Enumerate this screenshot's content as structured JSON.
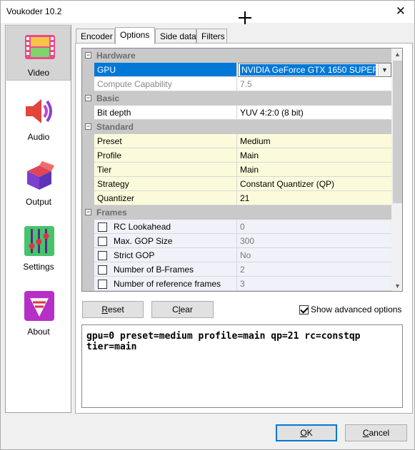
{
  "window": {
    "title": "Voukoder 10.2",
    "close_glyph": "✕"
  },
  "sidebar": {
    "items": [
      {
        "label": "Video",
        "icon": "film-icon",
        "selected": true
      },
      {
        "label": "Audio",
        "icon": "speaker-icon",
        "selected": false
      },
      {
        "label": "Output",
        "icon": "box-icon",
        "selected": false
      },
      {
        "label": "Settings",
        "icon": "sliders-icon",
        "selected": false
      },
      {
        "label": "About",
        "icon": "about-logo-icon",
        "selected": false
      }
    ]
  },
  "tabs": [
    {
      "label": "Encoder",
      "active": false
    },
    {
      "label": "Options",
      "active": true
    },
    {
      "label": "Side data",
      "active": false
    },
    {
      "label": "Filters",
      "active": false
    }
  ],
  "grid": {
    "categories": {
      "hardware": "Hardware",
      "basic": "Basic",
      "standard": "Standard",
      "frames": "Frames"
    },
    "hardware": [
      {
        "name": "GPU",
        "value": "NVIDIA GeForce GTX 1650 SUPER"
      },
      {
        "name": "Compute Capability",
        "value": "7.5"
      }
    ],
    "basic": [
      {
        "name": "Bit depth",
        "value": "YUV 4:2:0 (8 bit)"
      }
    ],
    "standard": [
      {
        "name": "Preset",
        "value": "Medium"
      },
      {
        "name": "Profile",
        "value": "Main"
      },
      {
        "name": "Tier",
        "value": "Main"
      },
      {
        "name": "Strategy",
        "value": "Constant Quantizer (QP)"
      },
      {
        "name": "Quantizer",
        "value": "21"
      }
    ],
    "frames": [
      {
        "name": "RC Lookahead",
        "value": "0",
        "checked": false
      },
      {
        "name": "Max. GOP Size",
        "value": "300",
        "checked": false
      },
      {
        "name": "Strict GOP",
        "value": "No",
        "checked": false
      },
      {
        "name": "Number of B-Frames",
        "value": "2",
        "checked": false
      },
      {
        "name": "Number of reference frames",
        "value": "3",
        "checked": false
      }
    ]
  },
  "buttons": {
    "reset": {
      "mnemonic": "R",
      "rest": "eset"
    },
    "clear": {
      "mnemonic": "l",
      "pre": "C",
      "rest": "ear"
    },
    "ok": {
      "mnemonic": "O",
      "rest": "K"
    },
    "cancel": {
      "mnemonic": "C",
      "rest": "ancel"
    }
  },
  "show_advanced": {
    "label": "Show advanced options",
    "checked": true
  },
  "command_line": "gpu=0 preset=medium profile=main qp=21 rc=constqp tier=main"
}
